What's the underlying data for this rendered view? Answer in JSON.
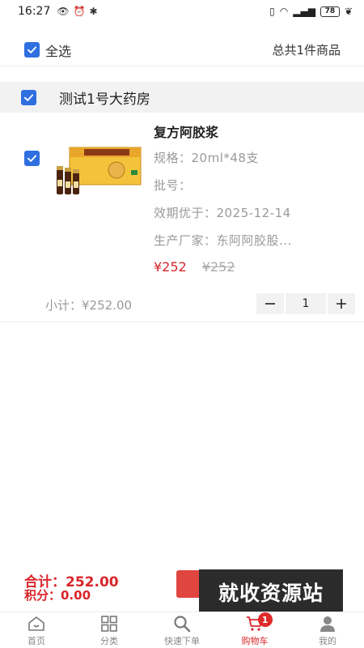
{
  "status_bar": {
    "time": "16:27",
    "battery": "78"
  },
  "topbar": {
    "select_all_label": "全选",
    "total_text": "总共1件商品",
    "select_all_checked": true
  },
  "store": {
    "name": "测试1号大药房",
    "checked": true
  },
  "product": {
    "name": "复方阿胶浆",
    "spec": "规格：20ml*48支",
    "batch": "批号：",
    "expiry": "效期优于：2025-12-14",
    "manufacturer": "生产厂家：东阿阿胶股...",
    "price": "¥252",
    "original_price": "¥252",
    "subtotal": "小计：¥252.00",
    "quantity": "1",
    "checked": true
  },
  "summary": {
    "total": "合计：252.00",
    "points": "积分：0.00"
  },
  "watermark": "就收资源站",
  "tabbar": {
    "items": [
      {
        "label": "首页",
        "icon": "home-icon"
      },
      {
        "label": "分类",
        "icon": "grid-icon"
      },
      {
        "label": "快速下单",
        "icon": "search-icon"
      },
      {
        "label": "购物车",
        "icon": "cart-icon",
        "active": true,
        "badge": "1"
      },
      {
        "label": "我的",
        "icon": "user-icon"
      }
    ]
  },
  "colors": {
    "accent": "#2f6fe0",
    "price": "#d8262b",
    "settle": "#e0453f"
  }
}
